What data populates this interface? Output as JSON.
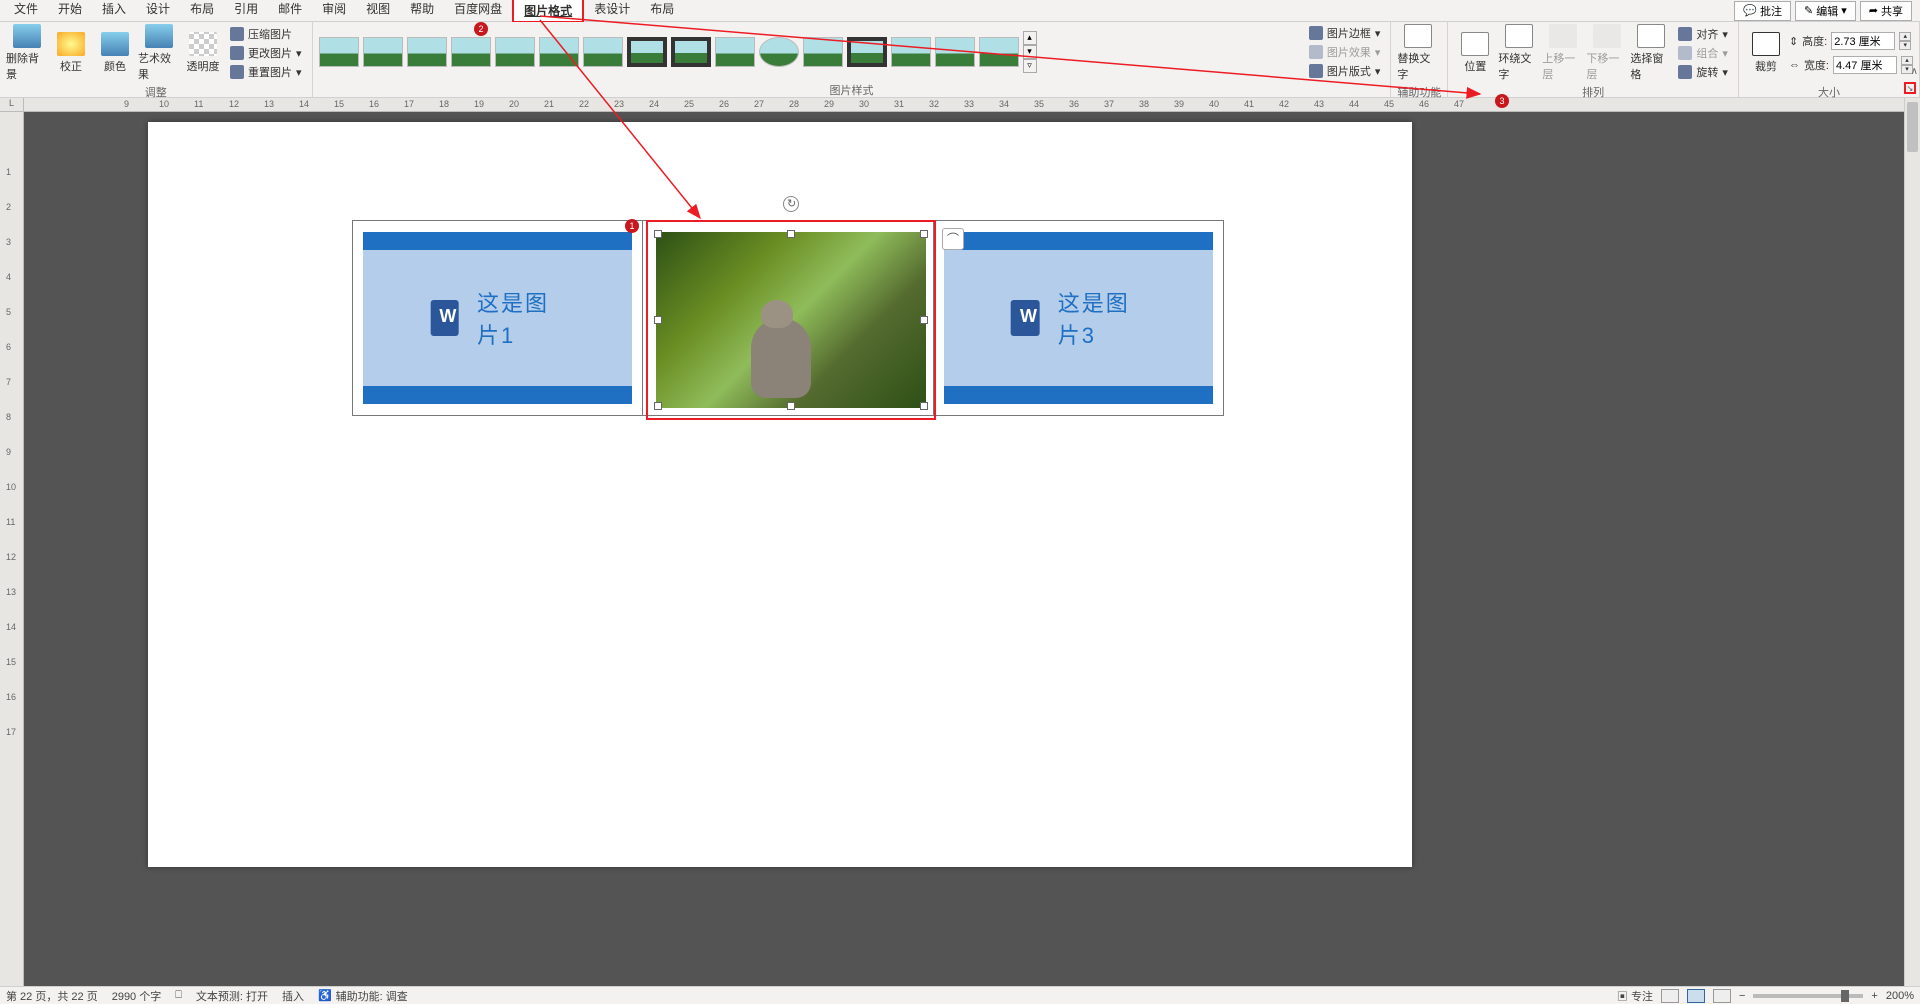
{
  "menu": {
    "tabs": [
      "文件",
      "开始",
      "插入",
      "设计",
      "布局",
      "引用",
      "邮件",
      "审阅",
      "视图",
      "帮助",
      "百度网盘",
      "图片格式",
      "表设计",
      "布局"
    ],
    "active_index": 11
  },
  "title_buttons": {
    "comments": "批注",
    "edit": "编辑",
    "share": "共享"
  },
  "ribbon": {
    "adjust": {
      "label": "调整",
      "remove_bg": "删除背景",
      "corrections": "校正",
      "color": "颜色",
      "artistic": "艺术效果",
      "transparency": "透明度",
      "compress": "压缩图片",
      "change": "更改图片",
      "reset": "重置图片"
    },
    "styles": {
      "label": "图片样式",
      "border": "图片边框",
      "effects": "图片效果",
      "layout": "图片版式"
    },
    "accessibility": {
      "label": "辅助功能",
      "alt_text": "替换文字"
    },
    "arrange": {
      "label": "排列",
      "position": "位置",
      "wrap": "环绕文字",
      "forward": "上移一层",
      "backward": "下移一层",
      "selection_pane": "选择窗格",
      "align": "对齐",
      "group": "组合",
      "rotate": "旋转"
    },
    "size": {
      "label": "大小",
      "crop": "裁剪",
      "height_label": "高度:",
      "height_value": "2.73 厘米",
      "width_label": "宽度:",
      "width_value": "4.47 厘米"
    }
  },
  "ruler_corner": "L",
  "annotations": {
    "n1": "1",
    "n2": "2",
    "n3": "3"
  },
  "doc": {
    "img1_text": "这是图片1",
    "img3_text": "这是图片3"
  },
  "status": {
    "page": "第 22 页，共 22 页",
    "words": "2990 个字",
    "text_predict": "文本预测: 打开",
    "insert_mode": "插入",
    "accessibility": "辅助功能: 调查",
    "focus": "专注",
    "zoom": "200%"
  }
}
